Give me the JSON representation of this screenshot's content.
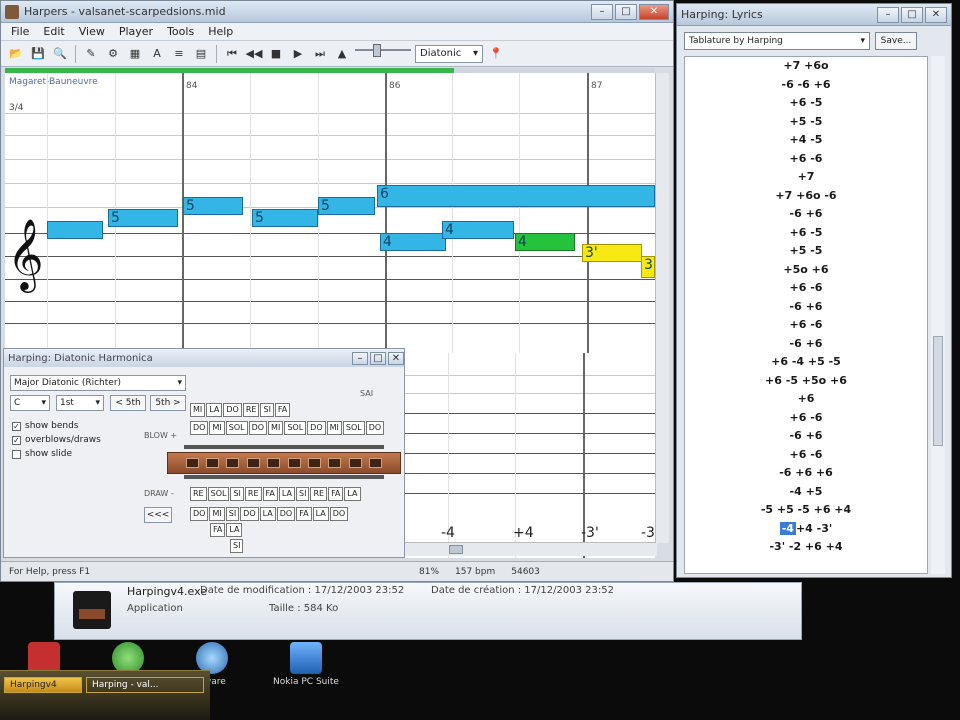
{
  "main_window": {
    "title": "Harpers - valsanet-scarpedsions.mid",
    "menu": [
      "File",
      "Edit",
      "View",
      "Player",
      "Tools",
      "Help"
    ],
    "scale_select": "Diatonic",
    "progress_fraction": 0.69
  },
  "score": {
    "header": "Magaret-Bauneuvre",
    "time_sig": "3/4",
    "measures": [
      "84",
      "86",
      "87"
    ],
    "notes": [
      {
        "label": "",
        "color": "blue"
      },
      {
        "label": "5",
        "color": "blue"
      },
      {
        "label": "5",
        "color": "blue"
      },
      {
        "label": "5",
        "color": "blue"
      },
      {
        "label": "5",
        "color": "blue"
      },
      {
        "label": "6",
        "color": "blue"
      },
      {
        "label": "4",
        "color": "blue"
      },
      {
        "label": "4",
        "color": "blue"
      },
      {
        "label": "4",
        "color": "green"
      },
      {
        "label": "3'",
        "color": "yellow"
      },
      {
        "label": "3",
        "color": "yellow"
      }
    ],
    "tab_labels": [
      "-4",
      "+4",
      "-3'",
      "-3"
    ]
  },
  "status": {
    "help": "For Help, press F1",
    "zoom": "81%",
    "tempo": "157 bpm",
    "position": "54603"
  },
  "harmonica_dialog": {
    "title": "Harping: Diatonic Harmonica",
    "tuning": "Major Diatonic (Richter)",
    "key": "C",
    "position": "1st",
    "minus_button": "< 5th",
    "plus_button": "5th >",
    "options": [
      {
        "label": "show bends",
        "checked": true
      },
      {
        "label": "overblows/draws",
        "checked": true
      },
      {
        "label": "show slide",
        "checked": false
      }
    ],
    "blow_label": "BLOW +",
    "draw_label": "DRAW -",
    "solfege_top_label": "SAI",
    "row_top": [
      "MI",
      "LA",
      "DO",
      "RE",
      "SI",
      "FA"
    ],
    "row_blow": [
      "DO",
      "MI",
      "SOL",
      "DO",
      "MI",
      "SOL",
      "DO",
      "MI",
      "SOL",
      "DO"
    ],
    "row_draw": [
      "RE",
      "SOL",
      "SI",
      "RE",
      "FA",
      "LA",
      "SI",
      "RE",
      "FA",
      "LA"
    ],
    "row_bend1": [
      "DO",
      "MI",
      "SI",
      "DO",
      "LA",
      "DO",
      "FA",
      "LA",
      "DO"
    ],
    "row_bend2": [
      "FA",
      "LA"
    ],
    "row_bend3": [
      "SI"
    ],
    "nav_button": "<<<"
  },
  "lyrics_window": {
    "title": "Harping: Lyrics",
    "select": "Tablature by Harping",
    "save_button": "Save...",
    "lines": [
      "+7 +6o",
      "-6 -6 +6",
      "+6 -5",
      "+5 -5",
      "+4 -5",
      "+6 -6",
      "+7",
      "+7 +6o -6",
      "-6 +6",
      "+6 -5",
      "+5 -5",
      "+5o +6",
      "+6 -6",
      "-6 +6",
      "+6 -6",
      "-6 +6",
      "+6 -4 +5 -5",
      "+6 -5 +5o +6",
      "+6",
      "+6 -6",
      "-6 +6",
      "+6 -6",
      "-6 +6 +6",
      "-4 +5",
      "-5 +5 -5 +6 +4"
    ],
    "highlight_line": {
      "highlighted": "-4",
      "rest": "+4 -3'"
    },
    "last_line": "-3' -2 +6 +4"
  },
  "explorer": {
    "name": "Harpingv4.exe",
    "type": "Application",
    "modified_label": "Date de modification : 17/12/2003 23:52",
    "created_label": "Date de création : 17/12/2003 23:52",
    "size_label": "Taille : 584 Ko"
  },
  "desktop": {
    "icons": [
      "Aware",
      "Nokia PC Suite"
    ]
  },
  "taskbar": {
    "items": [
      "Harpingv4",
      "Harping - val..."
    ]
  }
}
